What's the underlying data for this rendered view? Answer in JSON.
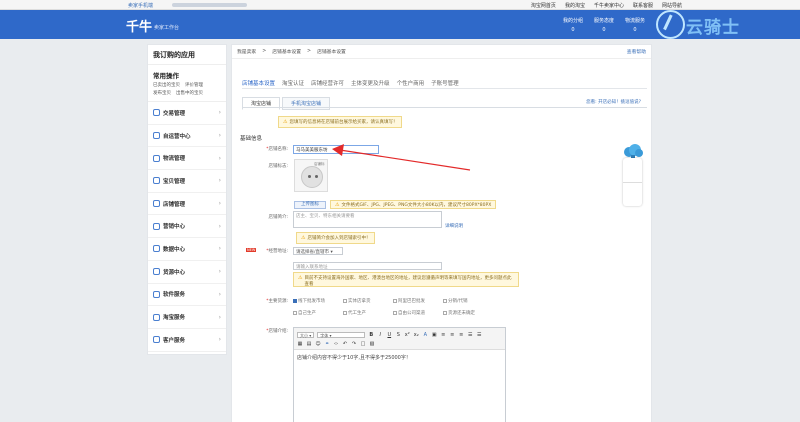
{
  "topstrip": {
    "left_label": "卖家手机端",
    "links": [
      "淘宝网首页",
      "我的淘宝",
      "千牛卖家中心",
      "联系客服",
      "网站导航"
    ]
  },
  "header": {
    "logo": "千牛",
    "logo_sub": "卖家工作台",
    "stats": [
      {
        "label": "我的分组",
        "value": "0"
      },
      {
        "label": "服务态度",
        "value": "0"
      },
      {
        "label": "物流服务",
        "value": "0"
      }
    ]
  },
  "watermark": {
    "text": "云骑士"
  },
  "sidebar": {
    "title": "我订购的应用",
    "common_title": "常用操作",
    "quick_links_row1": [
      "已卖出的宝贝",
      "评价管理"
    ],
    "quick_links_row2": [
      "发布宝贝",
      "出售中的宝贝"
    ],
    "items": [
      {
        "label": "交易管理"
      },
      {
        "label": "自运营中心"
      },
      {
        "label": "物流管理"
      },
      {
        "label": "宝贝管理"
      },
      {
        "label": "店铺管理"
      },
      {
        "label": "营销中心"
      },
      {
        "label": "数据中心"
      },
      {
        "label": "货源中心"
      },
      {
        "label": "软件服务"
      },
      {
        "label": "淘宝服务"
      },
      {
        "label": "客户服务"
      }
    ]
  },
  "breadcrumb": {
    "items": [
      "我是卖家",
      ">",
      "店铺基本设置",
      ">",
      "店铺基本设置"
    ],
    "help": "查看帮助"
  },
  "tabs_primary": [
    "店铺基本设置",
    "淘宝认证",
    "店铺经营许可",
    "主体变更及升级",
    "个性户商用",
    "子账号管理"
  ],
  "tabs_secondary": [
    "淘宝店铺",
    "手机淘宝店铺"
  ],
  "tabs_secondary_right": "您看: 开店必知！挑逗值说?",
  "top_tip": "您填写的信息将在店铺前台展示给买家，请认真填写！",
  "section_title": "基础信息",
  "form": {
    "shop_name_label": "店铺名称:",
    "shop_name_value": "马马美美服东坊",
    "shop_logo_label": "店铺标志:",
    "logo_tag": "店铺标",
    "upload_button": "上传图标",
    "upload_tip": "文件格式GIF、JPG、JPEG、PNG文件大小80K以内，建议尺寸80PX*80PX",
    "intro_label": "店铺简介:",
    "intro_placeholder": "店主、宝贝、特东相关请要看",
    "detail_link": "详细说明",
    "intro_tip": "店铺简介会加入到店铺索引中！",
    "location_label": "经营地址:",
    "location_select": "请选择省/直辖市",
    "address_placeholder": "请输入联系地址",
    "address_tip": "目前不支持设置海外国家、地区、港澳台地区的地址，建议您遵循声明等来填写国内地址，更多问题点此查看",
    "new_tag": "NEW",
    "source_label": "主要货源:",
    "sources_row1": [
      "线下批发市场",
      "实体店拿货",
      "阿里巴巴批发",
      "分销/代销"
    ],
    "sources_row2": [
      "自己生产",
      "代工生产",
      "自由公司渠道",
      "货源还未确定"
    ],
    "detail_label": "店铺介绍:",
    "editor_font_size": "大小",
    "editor_font_family": "字体",
    "editor_body": "店铺介绍内容不得少于10字,且不得多于25000字！"
  }
}
